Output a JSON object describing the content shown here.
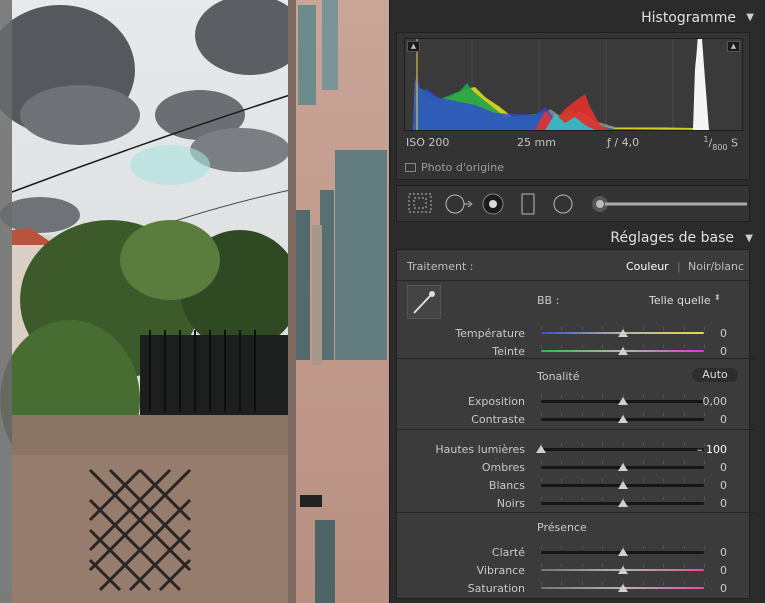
{
  "histogram": {
    "title": "Histogramme",
    "iso": "ISO 200",
    "focal": "25 mm",
    "aperture": "ƒ / 4,0",
    "shutter_num": "1",
    "shutter_den": "800",
    "shutter_unit": "S",
    "original_photo_label": "Photo d'origine"
  },
  "basic": {
    "title": "Réglages de base",
    "treatment_label": "Traitement :",
    "treatment_color": "Couleur",
    "treatment_bw": "Noir/blanc",
    "wb_label": "BB :",
    "wb_value": "Telle quelle",
    "tonality_label": "Tonalité",
    "auto_label": "Auto",
    "presence_label": "Présence"
  },
  "sliders": [
    {
      "label": "Température",
      "value": "0",
      "level": 0.5,
      "kind": "temp"
    },
    {
      "label": "Teinte",
      "value": "0",
      "level": 0.5,
      "kind": "tint"
    },
    {
      "label": "Exposition",
      "value": "0,00",
      "level": 0.5,
      "kind": "gray"
    },
    {
      "label": "Contraste",
      "value": "0",
      "level": 0.5,
      "kind": "gray"
    },
    {
      "label": "Hautes lumières",
      "value": "– 100",
      "level": 0.0,
      "kind": "gray"
    },
    {
      "label": "Ombres",
      "value": "0",
      "level": 0.5,
      "kind": "gray"
    },
    {
      "label": "Blancs",
      "value": "0",
      "level": 0.5,
      "kind": "gray"
    },
    {
      "label": "Noirs",
      "value": "0",
      "level": 0.5,
      "kind": "gray"
    },
    {
      "label": "Clarté",
      "value": "0",
      "level": 0.5,
      "kind": "gray"
    },
    {
      "label": "Vibrance",
      "value": "0",
      "level": 0.5,
      "kind": "vib"
    },
    {
      "label": "Saturation",
      "value": "0",
      "level": 0.5,
      "kind": "vib"
    }
  ],
  "colors": {
    "panel_bg": "#2b2b2b",
    "section_bg": "#3b3b3b",
    "accent_active": "#ffffff"
  }
}
